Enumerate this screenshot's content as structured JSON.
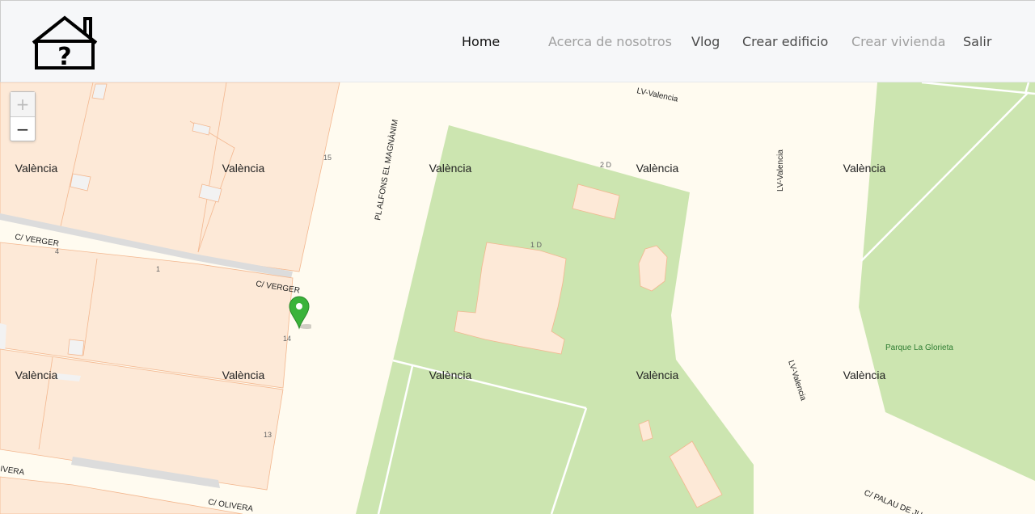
{
  "nav": {
    "home": "Home",
    "about": "Acerca de nosotros",
    "vlog": "Vlog",
    "create_building": "Crear edificio",
    "create_dwelling": "Crear vivienda",
    "logout": "Salir"
  },
  "map": {
    "zoom_in": "+",
    "zoom_out": "−",
    "labels": {
      "valencia": "València",
      "lv_valencia": "LV-Valencia",
      "c_verger": "C/ VERGER",
      "pl_alfons": "PL ALFONS EL MAGNÀNIM",
      "parque": "Parque La Glorieta",
      "c_olivera": "C/ OLIVERA",
      "c_palau": "C/ PALAU DE JU",
      "ivera": "IVERA",
      "n15": "15",
      "n2d": "2 D",
      "n1d": "1 D",
      "n4": "4",
      "n1": "1",
      "n14": "14",
      "n13": "13"
    }
  },
  "colors": {
    "map_bg": "#fffbf0",
    "parcel": "#fde9d7",
    "park": "#cce5b0",
    "marker": "#3ab33a"
  }
}
